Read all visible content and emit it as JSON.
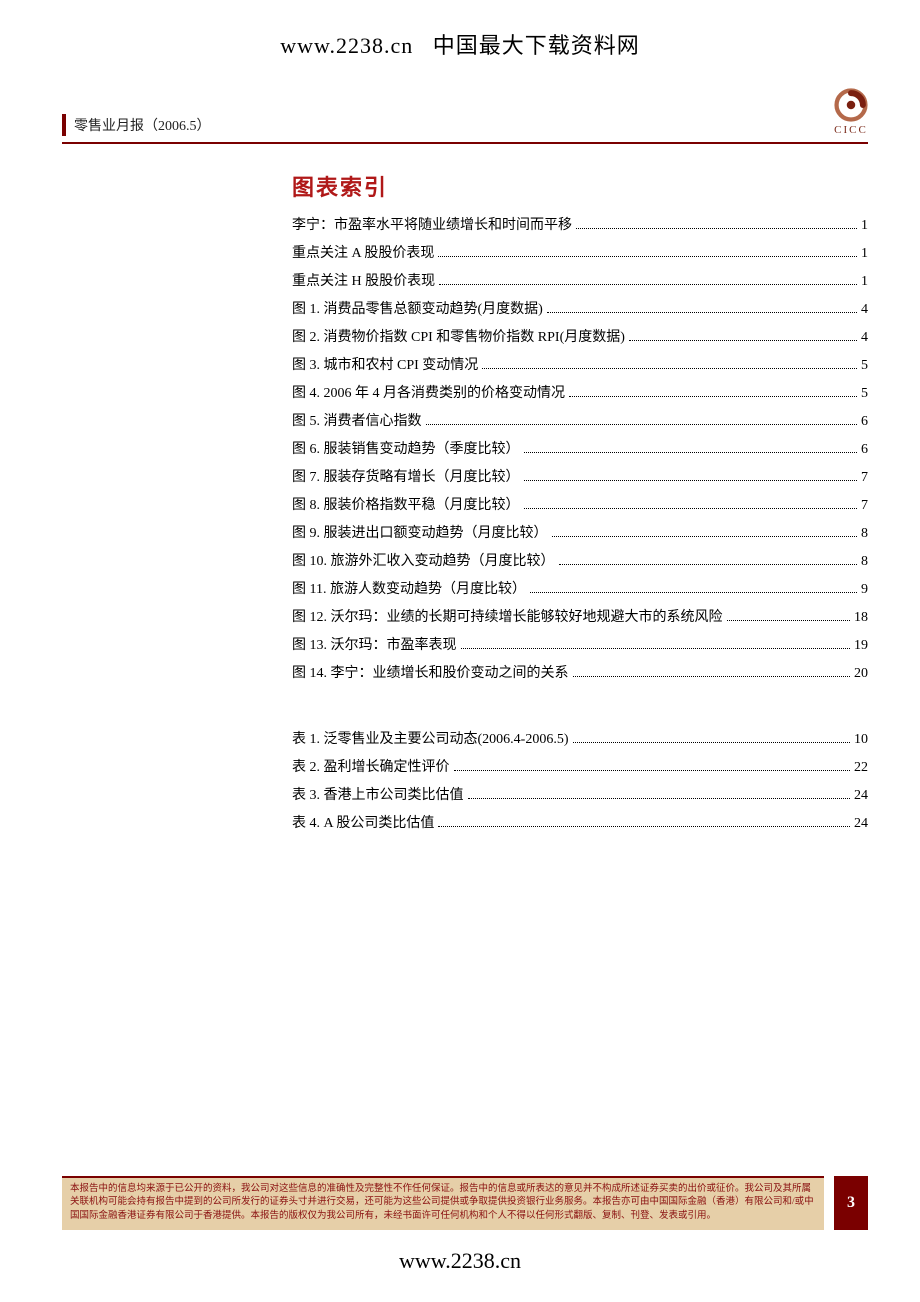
{
  "top": {
    "url": "www.2238.cn",
    "site_name": "中国最大下载资料网"
  },
  "header": {
    "doc_title": "零售业月报（2006.5）",
    "logo_text": "CICC"
  },
  "section_title": "图表索引",
  "figures": [
    {
      "label": "李宁：市盈率水平将随业绩增长和时间而平移",
      "page": "1"
    },
    {
      "label": "重点关注 A 股股价表现",
      "page": "1"
    },
    {
      "label": "重点关注 H 股股价表现",
      "page": "1"
    },
    {
      "label": "图 1. 消费品零售总额变动趋势(月度数据)",
      "page": "4"
    },
    {
      "label": "图 2. 消费物价指数 CPI 和零售物价指数 RPI(月度数据)",
      "page": "4"
    },
    {
      "label": "图 3. 城市和农村 CPI 变动情况",
      "page": "5"
    },
    {
      "label": "图 4. 2006 年 4 月各消费类别的价格变动情况",
      "page": "5"
    },
    {
      "label": "图 5. 消费者信心指数",
      "page": "6"
    },
    {
      "label": "图 6. 服装销售变动趋势（季度比较）",
      "page": "6"
    },
    {
      "label": "图 7. 服装存货略有增长（月度比较）",
      "page": "7"
    },
    {
      "label": "图 8. 服装价格指数平稳（月度比较）",
      "page": "7"
    },
    {
      "label": "图 9. 服装进出口额变动趋势（月度比较）",
      "page": "8"
    },
    {
      "label": "图 10. 旅游外汇收入变动趋势（月度比较）",
      "page": "8"
    },
    {
      "label": "图 11. 旅游人数变动趋势（月度比较）",
      "page": "9"
    },
    {
      "label": "图 12. 沃尔玛：业绩的长期可持续增长能够较好地规避大市的系统风险",
      "page": "18"
    },
    {
      "label": "图 13. 沃尔玛：市盈率表现",
      "page": "19"
    },
    {
      "label": "图 14. 李宁：业绩增长和股价变动之间的关系",
      "page": "20"
    }
  ],
  "tables": [
    {
      "label": "表 1. 泛零售业及主要公司动态(2006.4-2006.5)",
      "page": "10"
    },
    {
      "label": "表 2. 盈利增长确定性评价",
      "page": "22"
    },
    {
      "label": "表 3. 香港上市公司类比估值",
      "page": "24"
    },
    {
      "label": "表 4. A 股公司类比估值",
      "page": "24"
    }
  ],
  "footer": {
    "disclaimer": "本报告中的信息均来源于已公开的资料，我公司对这些信息的准确性及完整性不作任何保证。报告中的信息或所表达的意见并不构成所述证券买卖的出价或征价。我公司及其所属关联机构可能会持有报告中提到的公司所发行的证券头寸并进行交易，还可能为这些公司提供或争取提供投资银行业务服务。本报告亦可由中国国际金融（香港）有限公司和/或中国国际金融香港证券有限公司于香港提供。本报告的版权仅为我公司所有，未经书面许可任何机构和个人不得以任何形式翻版、复制、刊登、发表或引用。",
    "page_number": "3"
  },
  "bottom_url": "www.2238.cn"
}
